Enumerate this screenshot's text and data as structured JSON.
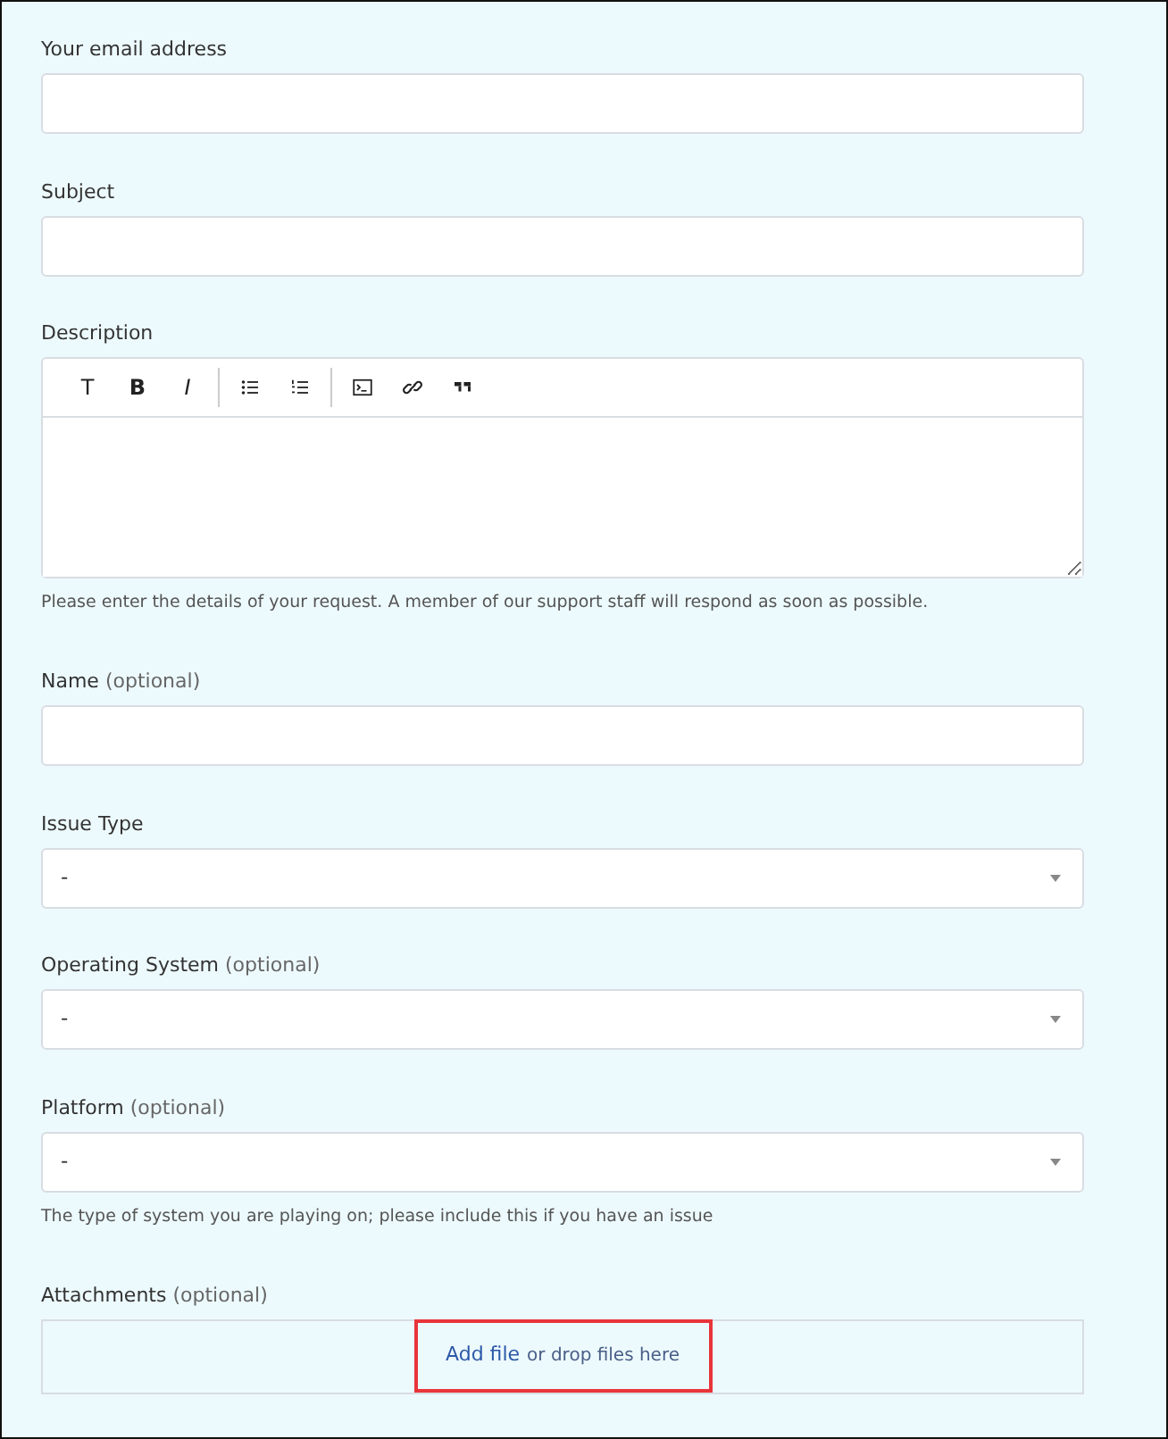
{
  "fields": [
    {
      "kind": "input",
      "label": "Your email address"
    },
    {
      "kind": "input",
      "label": "Subject"
    },
    {
      "kind": "editor",
      "label": "Description",
      "toolbar": [
        [
          {
            "kind": "plain",
            "label": "T"
          },
          {
            "kind": "bold",
            "label": "B"
          },
          {
            "kind": "italic",
            "label": "I"
          }
        ],
        [
          {
            "kind": "bullets"
          },
          {
            "kind": "numbers"
          }
        ],
        [
          {
            "kind": "terminal"
          },
          {
            "kind": "link"
          },
          {
            "kind": "quote"
          }
        ]
      ],
      "help": "Please enter the details of your request. A member of our support staff will respond as soon as possible."
    },
    {
      "kind": "input",
      "label": "Name",
      "note": "(optional)"
    },
    {
      "kind": "select",
      "label": "Issue Type",
      "value": "-"
    },
    {
      "kind": "select",
      "label": "Operating System",
      "note": "(optional)",
      "value": "-"
    },
    {
      "kind": "select",
      "label": "Platform",
      "note": "(optional)",
      "value": "-",
      "help": "The type of system you are playing on; please include this if you have an issue"
    },
    {
      "kind": "dropzone",
      "label": "Attachments",
      "note": "(optional)",
      "link": "Add file",
      "text": "or drop files here",
      "highlighted": true
    }
  ]
}
